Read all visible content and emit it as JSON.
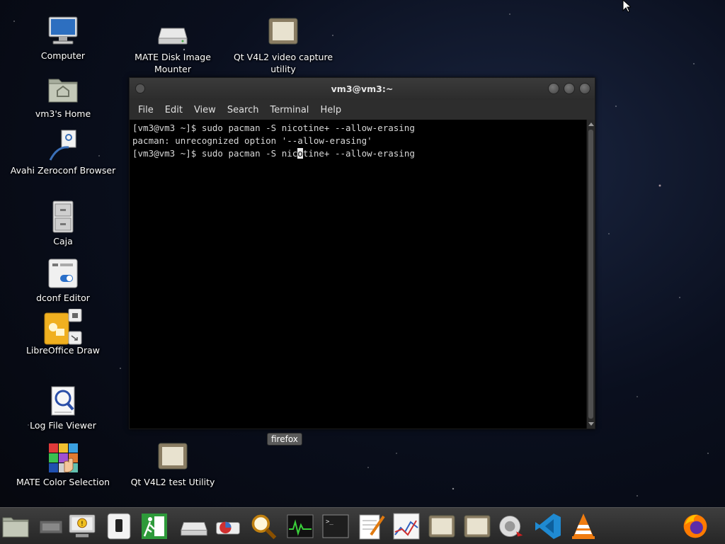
{
  "desktop": {
    "icons": [
      {
        "name": "computer",
        "label": "Computer"
      },
      {
        "name": "home",
        "label": "vm3's Home"
      },
      {
        "name": "avahi",
        "label": "Avahi Zeroconf Browser"
      },
      {
        "name": "caja",
        "label": "Caja"
      },
      {
        "name": "dconf",
        "label": "dconf Editor"
      },
      {
        "name": "libreoffice-draw",
        "label": "LibreOffice Draw"
      },
      {
        "name": "log-viewer",
        "label": "Log File Viewer"
      },
      {
        "name": "color-selection",
        "label": "MATE Color Selection"
      },
      {
        "name": "disk-mounter",
        "label": "MATE Disk Image Mounter"
      },
      {
        "name": "qt-v4l2-capture",
        "label": "Qt V4L2 video capture utility"
      },
      {
        "name": "qt-v4l2-test",
        "label": "Qt V4L2 test Utility"
      }
    ]
  },
  "terminal": {
    "title": "vm3@vm3:~",
    "menu": [
      "File",
      "Edit",
      "View",
      "Search",
      "Terminal",
      "Help"
    ],
    "lines": [
      "[vm3@vm3 ~]$ sudo pacman -S nicotine+ --allow-erasing",
      "pacman: unrecognized option '--allow-erasing'"
    ],
    "current_line_before_cursor": "[vm3@vm3 ~]$ sudo pacman -S nic",
    "cursor_char": "o",
    "current_line_after_cursor": "tine+ --allow-erasing"
  },
  "tooltip": "firefox",
  "colors": {
    "titlebar": "#2c2c2c",
    "terminal_bg": "#000000",
    "terminal_fg": "#d8d8d8",
    "taskbar": "#2e2e2e"
  },
  "taskbar": {
    "launchers": [
      "file-manager-icon",
      "network-icon",
      "remote-desktop-icon",
      "tablet-icon",
      "logout-icon",
      "disk-icon",
      "disk-usage-icon",
      "magnifier-icon",
      "system-monitor-icon",
      "terminal-icon",
      "text-editor-icon",
      "chart-icon",
      "qt-v4l2-icon",
      "qt-v4l2-icon-2",
      "nautilus-icon",
      "vscode-icon",
      "vlc-icon",
      "firefox-icon"
    ]
  }
}
